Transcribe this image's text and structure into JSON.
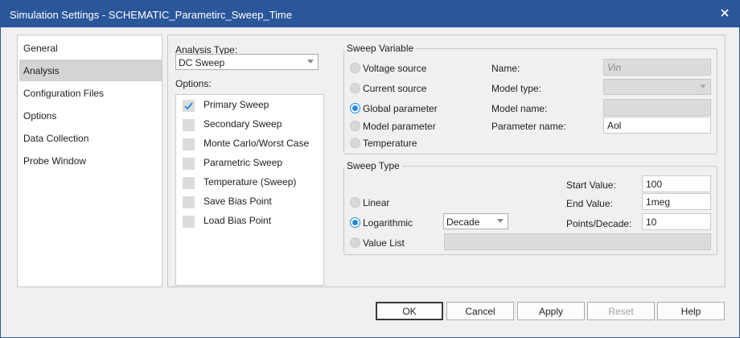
{
  "window": {
    "title": "Simulation Settings - SCHEMATIC_Parametirc_Sweep_Time",
    "close_icon": "close-icon"
  },
  "nav": {
    "items": [
      {
        "label": "General",
        "selected": false
      },
      {
        "label": "Analysis",
        "selected": true
      },
      {
        "label": "Configuration Files",
        "selected": false
      },
      {
        "label": "Options",
        "selected": false
      },
      {
        "label": "Data Collection",
        "selected": false
      },
      {
        "label": "Probe Window",
        "selected": false
      }
    ]
  },
  "analysis": {
    "type_label": "Analysis Type:",
    "type_value": "DC Sweep",
    "options_label": "Options:",
    "options": [
      {
        "label": "Primary Sweep",
        "checked": true
      },
      {
        "label": "Secondary Sweep",
        "checked": false
      },
      {
        "label": "Monte Carlo/Worst Case",
        "checked": false
      },
      {
        "label": "Parametric Sweep",
        "checked": false
      },
      {
        "label": "Temperature (Sweep)",
        "checked": false
      },
      {
        "label": "Save Bias Point",
        "checked": false
      },
      {
        "label": "Load Bias Point",
        "checked": false
      }
    ]
  },
  "sweep_variable": {
    "title": "Sweep Variable",
    "radios": [
      {
        "label": "Voltage source",
        "selected": false
      },
      {
        "label": "Current source",
        "selected": false
      },
      {
        "label": "Global parameter",
        "selected": true
      },
      {
        "label": "Model parameter",
        "selected": false
      },
      {
        "label": "Temperature",
        "selected": false
      }
    ],
    "name_label": "Name:",
    "name_value": "Vin",
    "model_type_label": "Model type:",
    "model_type_value": "",
    "model_name_label": "Model name:",
    "model_name_value": "",
    "param_name_label": "Parameter name:",
    "param_name_value": "Aol"
  },
  "sweep_type": {
    "title": "Sweep Type",
    "radios": [
      {
        "label": "Linear",
        "selected": false
      },
      {
        "label": "Logarithmic",
        "selected": true
      },
      {
        "label": "Value List",
        "selected": false
      }
    ],
    "log_scale_value": "Decade",
    "start_label": "Start Value:",
    "start_value": "100",
    "end_label": "End Value:",
    "end_value": "1meg",
    "points_label": "Points/Decade:",
    "points_value": "10",
    "value_list_value": ""
  },
  "buttons": {
    "ok": "OK",
    "cancel": "Cancel",
    "apply": "Apply",
    "reset": "Reset",
    "help": "Help"
  },
  "colors": {
    "titlebar": "#2b579a",
    "accent": "#1e8bde",
    "selected_nav": "#d4d4d4"
  }
}
